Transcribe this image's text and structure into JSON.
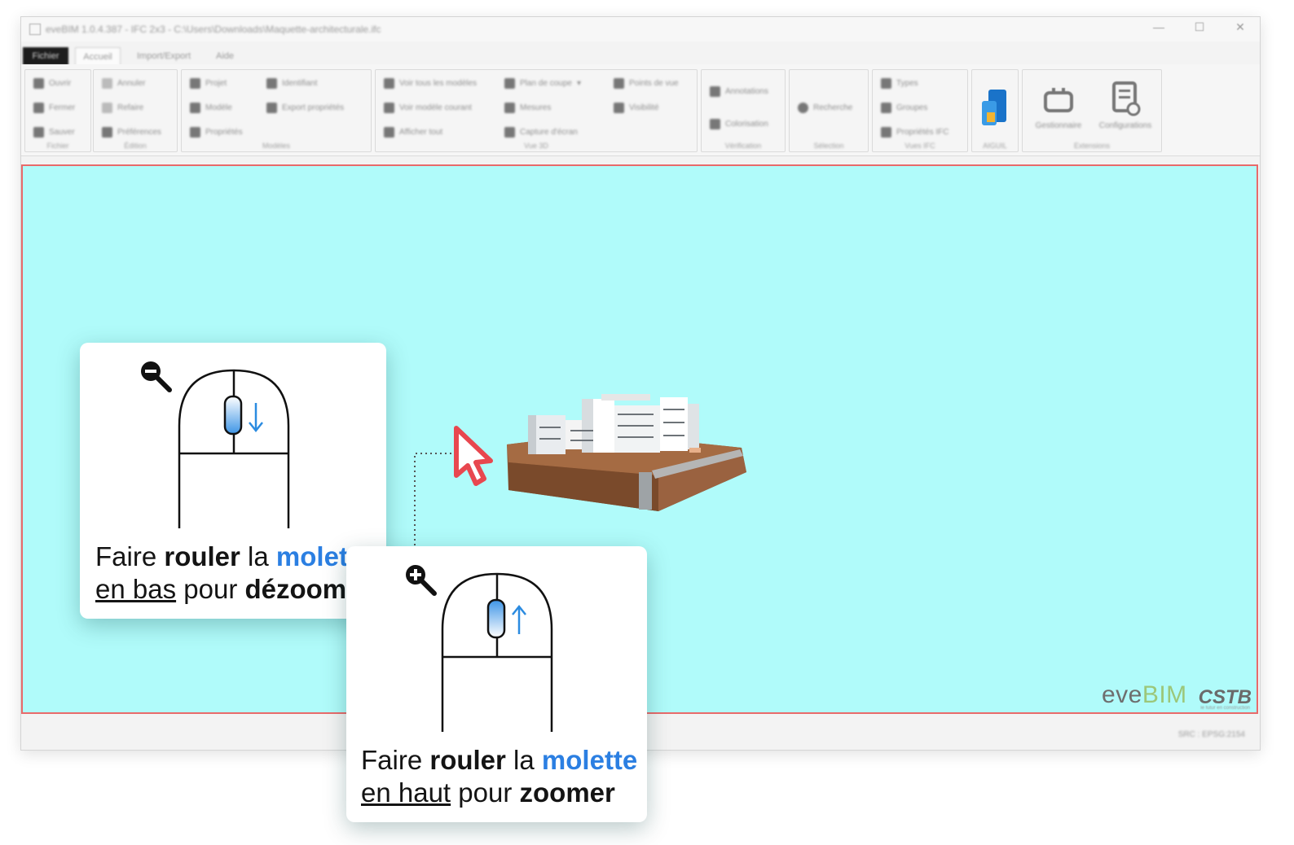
{
  "window": {
    "title": "eveBIM 1.0.4.387 - IFC 2x3 - C:\\Users\\Downloads\\Maquette-architecturale.ifc",
    "controls": [
      "—",
      "☐",
      "✕"
    ]
  },
  "tabs": [
    "Fichier",
    "Accueil",
    "Import/Export",
    "Aide"
  ],
  "ribbon": {
    "groups": [
      {
        "label": "Fichier",
        "items": [
          "Ouvrir",
          "Fermer",
          "Sauver"
        ]
      },
      {
        "label": "Édition",
        "items": [
          "Annuler",
          "Refaire",
          "Préférences"
        ]
      },
      {
        "label": "Modèles",
        "items": [
          "Projet",
          "Modèle",
          "Propriétés",
          "Identifiant",
          "Export propriétés"
        ]
      },
      {
        "label": "Vue 3D",
        "items": [
          "Voir tous les modèles",
          "Voir modèle courant",
          "Afficher tout",
          "Plan de coupe",
          "Mesures",
          "Capture d'écran",
          "Points de vue",
          "Visibilité"
        ]
      },
      {
        "label": "Vérification",
        "items": [
          "Annotations",
          "Colorisation"
        ]
      },
      {
        "label": "Sélection",
        "items": [
          "Recherche"
        ]
      },
      {
        "label": "Vues IFC",
        "items": [
          "Types",
          "Groupes",
          "Propriétés IFC"
        ]
      },
      {
        "label": "AIGUIL",
        "items": []
      },
      {
        "label": "Extensions",
        "items": [
          "Gestionnaire",
          "Configurations"
        ]
      }
    ]
  },
  "viewport": {
    "background": "#b0fbfa",
    "border_color": "#e86a6a"
  },
  "brand": {
    "eve": "eve",
    "bim": "BIM",
    "cstb": "CSTB",
    "cstb_sub": "le futur en construction"
  },
  "status": {
    "text": "SRC : EPSG:2154"
  },
  "card_zoom_out": {
    "icon": "zoom-out-icon",
    "line1": {
      "a": "Faire ",
      "b": "rouler",
      "c": " la ",
      "d": "molette"
    },
    "line2": {
      "a": "en bas",
      "b": " pour ",
      "c": "dézoomer"
    }
  },
  "card_zoom_in": {
    "icon": "zoom-in-icon",
    "line1": {
      "a": "Faire ",
      "b": "rouler",
      "c": " la ",
      "d": "molette"
    },
    "line2": {
      "a": "en haut",
      "b": " pour ",
      "c": "zoomer"
    }
  },
  "colors": {
    "accent_blue": "#2b7fe2",
    "cursor_red": "#e8474f",
    "brand_green": "#9cc77a"
  }
}
